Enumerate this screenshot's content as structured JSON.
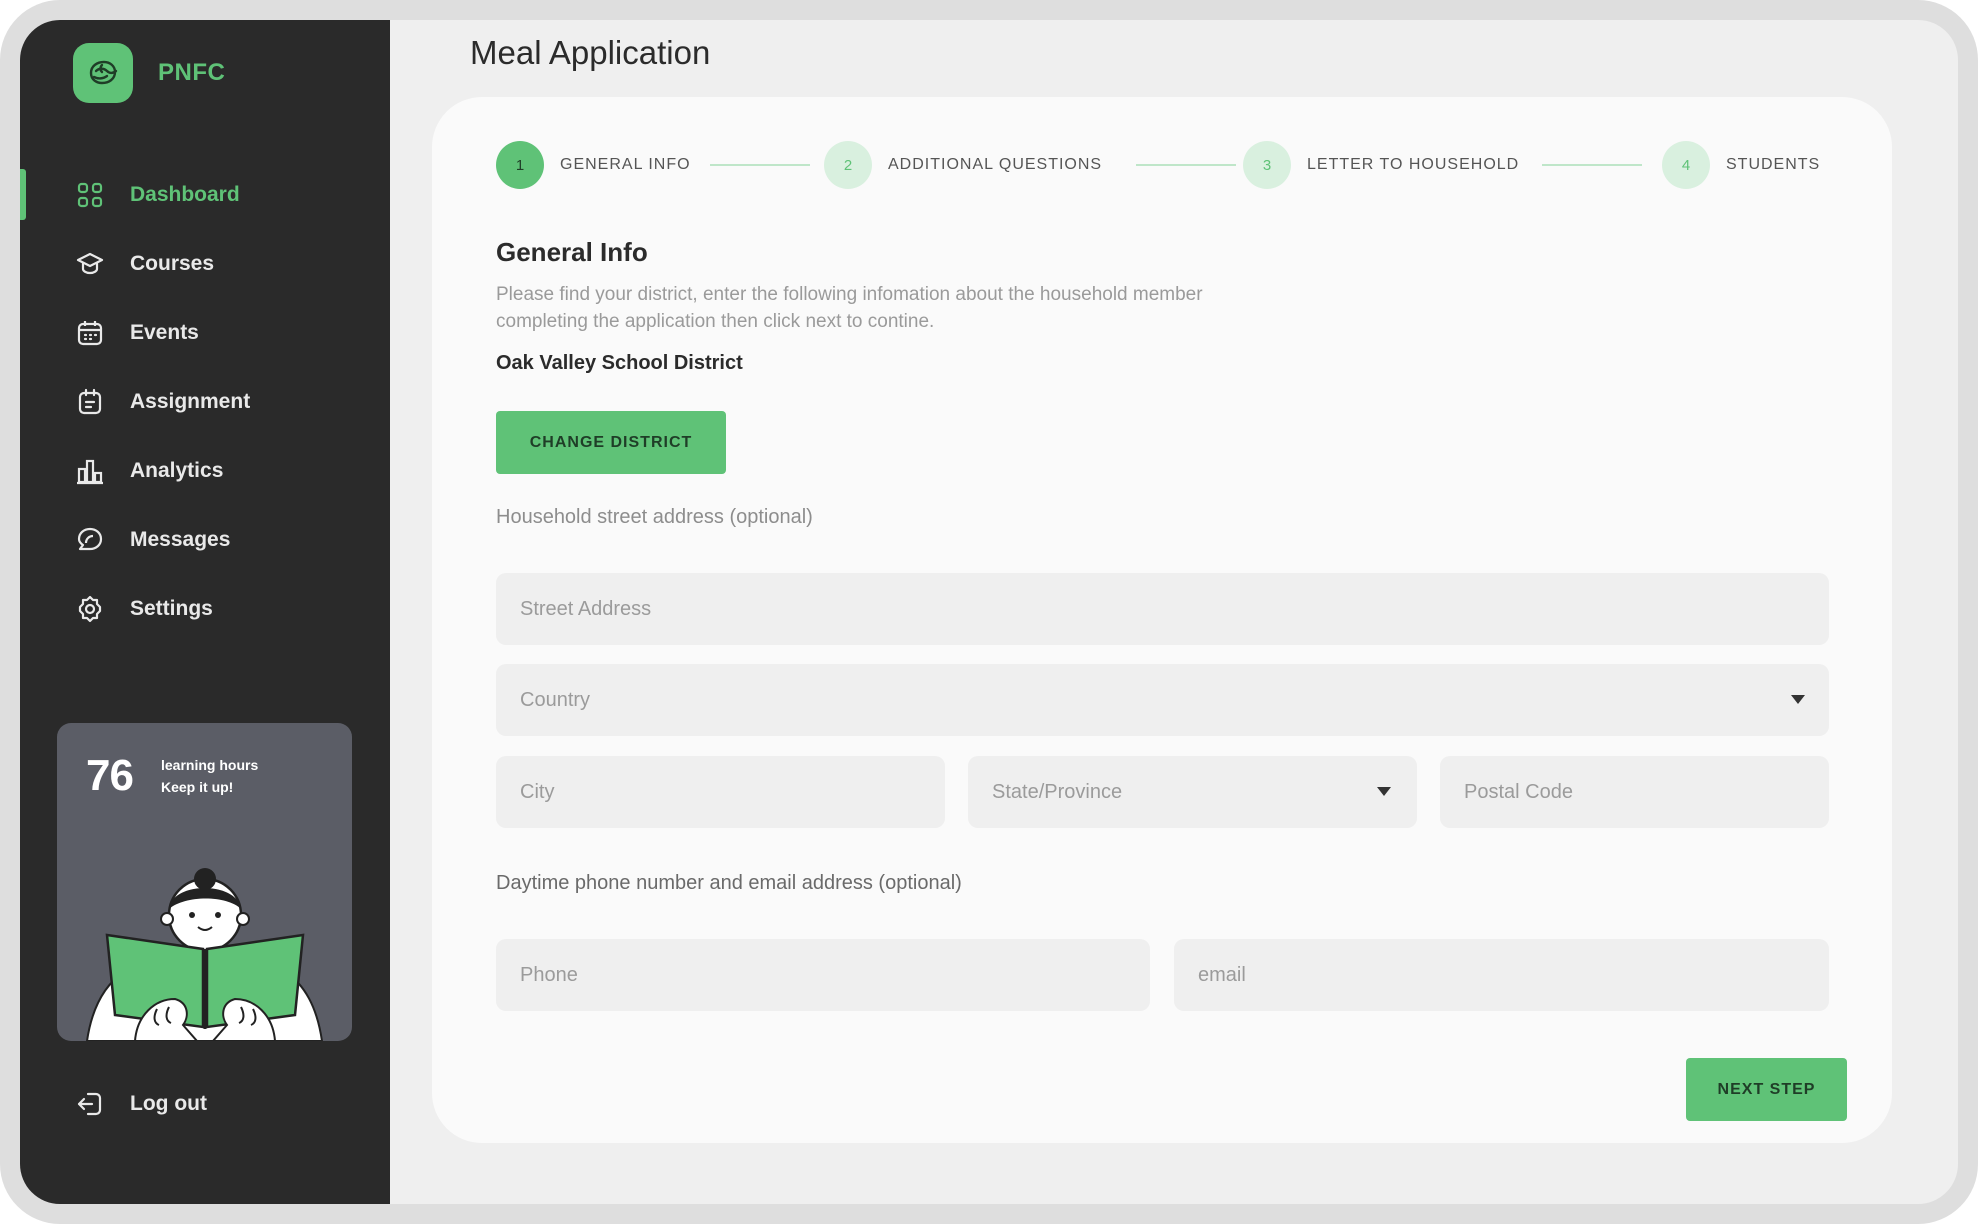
{
  "brand": {
    "name": "PNFC"
  },
  "nav": {
    "items": [
      {
        "label": "Dashboard",
        "icon": "grid-icon",
        "active": true
      },
      {
        "label": "Courses",
        "icon": "graduation-cap-icon"
      },
      {
        "label": "Events",
        "icon": "calendar-icon"
      },
      {
        "label": "Assignment",
        "icon": "clipboard-icon"
      },
      {
        "label": "Analytics",
        "icon": "bar-chart-icon"
      },
      {
        "label": "Messages",
        "icon": "chat-icon"
      },
      {
        "label": "Settings",
        "icon": "gear-icon"
      }
    ],
    "logout": "Log out"
  },
  "promo": {
    "hours": "76",
    "line1": "learning hours",
    "line2": "Keep it up!"
  },
  "page": {
    "title": "Meal Application"
  },
  "stepper": {
    "steps": [
      {
        "num": "1",
        "label": "GENERAL INFO",
        "active": true
      },
      {
        "num": "2",
        "label": "ADDITIONAL QUESTIONS"
      },
      {
        "num": "3",
        "label": "LETTER TO HOUSEHOLD"
      },
      {
        "num": "4",
        "label": "STUDENTS"
      }
    ]
  },
  "section": {
    "title": "General Info",
    "description": "Please find your district, enter the following infomation about the household member completing the application then click next to contine.",
    "district": "Oak Valley School District",
    "change_district": "CHANGE DISTRICT",
    "address_label": "Household street address (optional)",
    "contact_label": "Daytime phone number and email address (optional)",
    "next_step": "NEXT STEP"
  },
  "fields": {
    "street": "Street Address",
    "country": "Country",
    "city": "City",
    "state": "State/Province",
    "postal": "Postal Code",
    "phone": "Phone",
    "email": "email"
  },
  "colors": {
    "accent": "#5fc277",
    "sidebar": "#2a2a2a",
    "promo": "#5b5d66"
  }
}
